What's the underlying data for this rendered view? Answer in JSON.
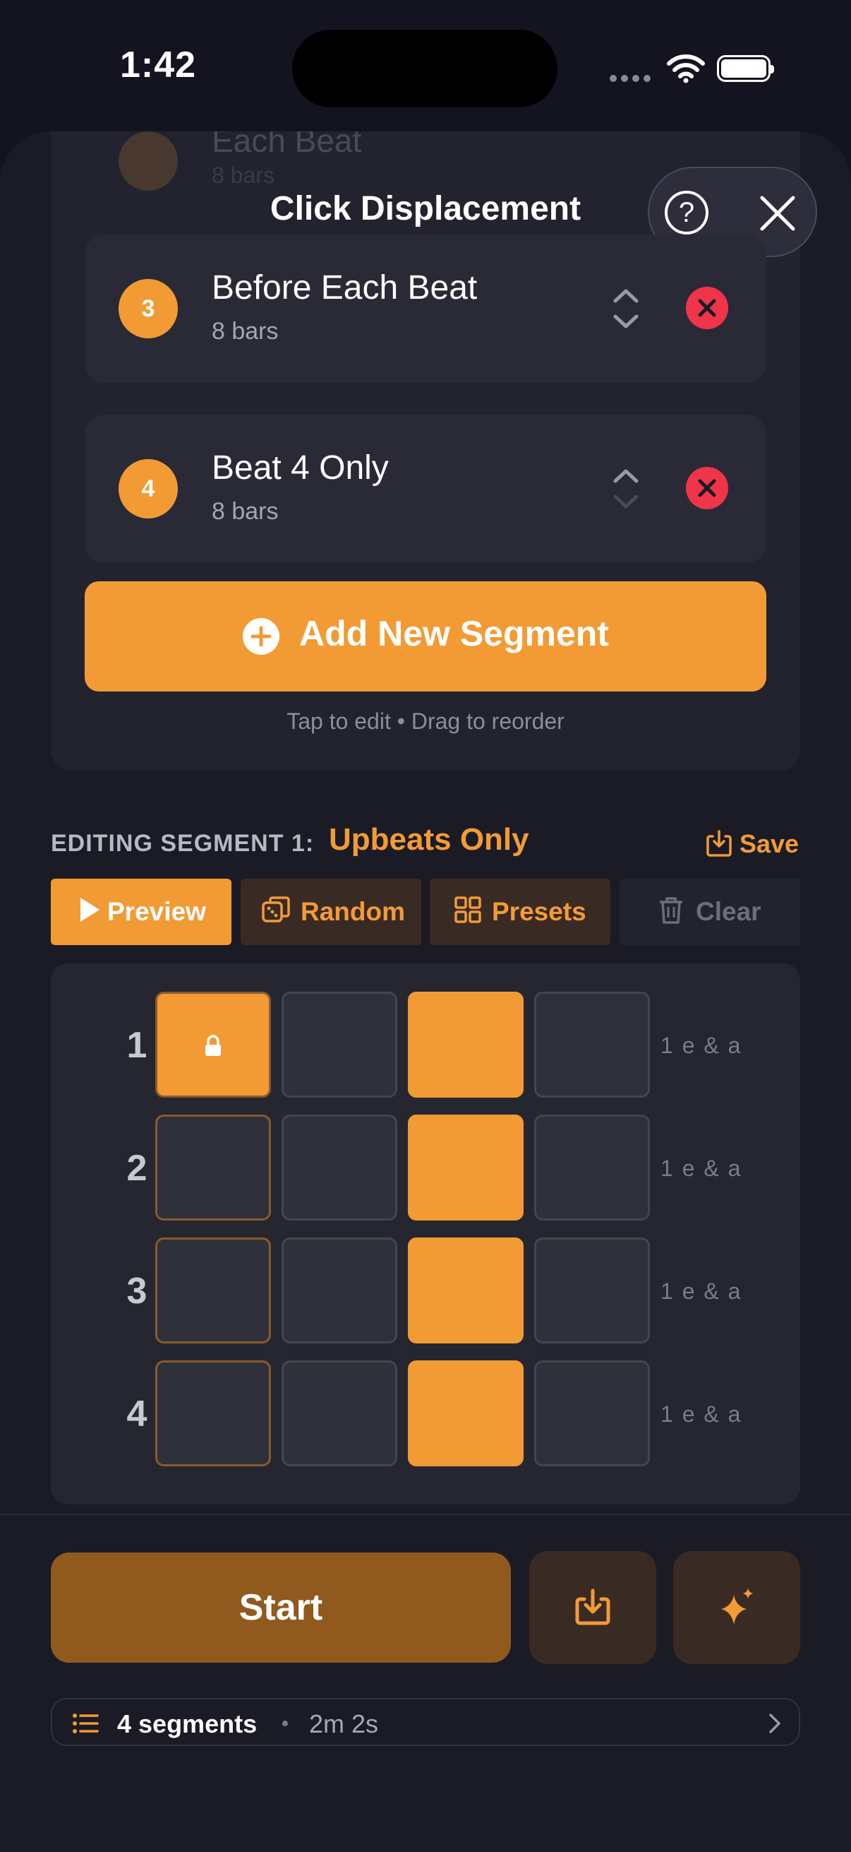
{
  "status_bar": {
    "time": "1:42"
  },
  "sheet": {
    "title": "Click Displacement",
    "ghost_segment": {
      "title": "Each Beat",
      "subtitle": "8 bars"
    },
    "segments": [
      {
        "number": "3",
        "title": "Before Each Beat",
        "subtitle": "8 bars"
      },
      {
        "number": "4",
        "title": "Beat 4 Only",
        "subtitle": "8 bars"
      }
    ],
    "add_button": "Add New Segment",
    "hint": "Tap to edit • Drag to reorder"
  },
  "editor": {
    "label": "EDITING SEGMENT 1:",
    "segment_name": "Upbeats Only",
    "save": "Save",
    "toolbar": {
      "preview": "Preview",
      "random": "Random",
      "presets": "Presets",
      "clear": "Clear"
    },
    "rows": [
      {
        "num": "1",
        "cells": [
          true,
          false,
          true,
          false
        ],
        "locked_first": true,
        "hint": "1 e & a"
      },
      {
        "num": "2",
        "cells": [
          false,
          false,
          true,
          false
        ],
        "locked_first": false,
        "hint": "1 e & a"
      },
      {
        "num": "3",
        "cells": [
          false,
          false,
          true,
          false
        ],
        "locked_first": false,
        "hint": "1 e & a"
      },
      {
        "num": "4",
        "cells": [
          false,
          false,
          true,
          false
        ],
        "locked_first": false,
        "hint": "1 e & a"
      }
    ]
  },
  "bottom": {
    "start": "Start",
    "segment_count": "4 segments",
    "duration": "2m 2s"
  },
  "colors": {
    "accent": "#f29b35",
    "danger": "#f0354b",
    "background": "#141420",
    "panel": "#23232f"
  }
}
